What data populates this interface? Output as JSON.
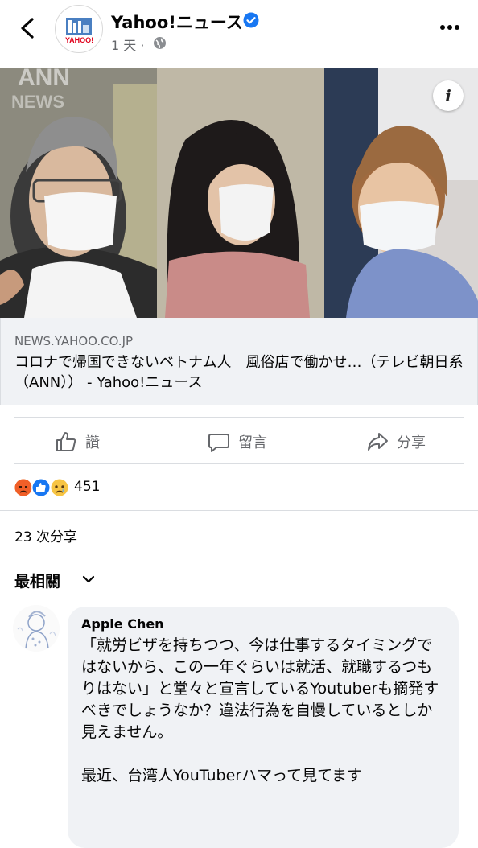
{
  "header": {
    "page_name": "Yahoo!ニュース",
    "time": "1 天 ·",
    "avatar_logo_text": "YAHOO!"
  },
  "photo": {
    "watermark_line1": "ANN",
    "watermark_line2": "NEWS"
  },
  "link": {
    "domain": "NEWS.YAHOO.CO.JP",
    "title": "コロナで帰国できないベトナム人　風俗店で働かせ…（テレビ朝日系（ANN））  - Yahoo!ニュース"
  },
  "actions": {
    "like": "讚",
    "comment": "留言",
    "share": "分享"
  },
  "reactions": {
    "count": "451",
    "types": [
      "angry",
      "like",
      "sad"
    ]
  },
  "shares": "23 次分享",
  "sort": {
    "label": "最相關"
  },
  "comment": {
    "author": "Apple Chen",
    "text": "「就労ビザを持ちつつ、今は仕事するタイミングではないから、この一年ぐらいは就活、就職するつもりはない」と堂々と宣言しているYoutuberも摘発すべきでしょうなか？違法行為を自慢しているとしか見えません。\n\n最近、台湾人YouTuberハマって見てます"
  },
  "colors": {
    "accent": "#1877f2",
    "secondary_text": "#65676b",
    "divider": "#dadde1"
  }
}
